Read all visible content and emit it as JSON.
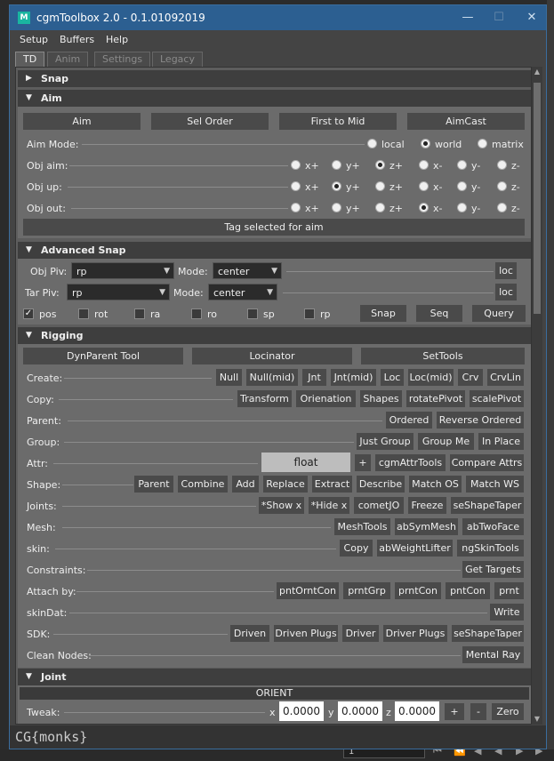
{
  "window": {
    "title": "cgmToolbox 2.0 - 0.1.01092019",
    "icon": "M"
  },
  "menu": [
    "Setup",
    "Buffers",
    "Help"
  ],
  "tabs": [
    "TD",
    "Anim",
    "Settings",
    "Legacy"
  ],
  "sections": {
    "snap": "Snap",
    "aim": "Aim",
    "advanced_snap": "Advanced Snap",
    "rigging": "Rigging",
    "joint": "Joint"
  },
  "aim": {
    "buttons": [
      "Aim",
      "Sel Order",
      "First to Mid",
      "AimCast"
    ],
    "mode_label": "Aim Mode:",
    "modes": [
      "local",
      "world",
      "matrix"
    ],
    "obj_aim_label": "Obj aim:",
    "obj_up_label": "Obj up:",
    "obj_out_label": "Obj out:",
    "axes": [
      "x+",
      "y+",
      "z+",
      "x-",
      "y-",
      "z-"
    ],
    "tag_button": "Tag selected for aim"
  },
  "advanced_snap": {
    "obj_piv_label": "Obj Piv:",
    "obj_piv_value": "rp",
    "tar_piv_label": "Tar Piv:",
    "tar_piv_value": "rp",
    "mode_label": "Mode:",
    "mode1_value": "center",
    "mode2_value": "center",
    "loc": "loc",
    "checks": [
      "pos",
      "rot",
      "ra",
      "ro",
      "sp",
      "rp"
    ],
    "snap": "Snap",
    "seq": "Seq",
    "query": "Query"
  },
  "rigging": {
    "top_buttons": [
      "DynParent Tool",
      "Locinator",
      "SetTools"
    ],
    "rows": [
      {
        "label": "Create:",
        "buttons": [
          "Null",
          "Null(mid)",
          "Jnt",
          "Jnt(mid)",
          "Loc",
          "Loc(mid)",
          "Crv",
          "CrvLin"
        ]
      },
      {
        "label": "Copy:",
        "buttons": [
          "Transform",
          "Orienation",
          "Shapes",
          "rotatePivot",
          "scalePivot"
        ]
      },
      {
        "label": "Parent:",
        "buttons": [
          "Ordered",
          "Reverse Ordered"
        ]
      },
      {
        "label": "Group:",
        "buttons": [
          "Just Group",
          "Group Me",
          "In Place"
        ]
      },
      {
        "label": "Attr:",
        "buttons": [
          "+",
          "cgmAttrTools",
          "Compare Attrs"
        ],
        "field": "float"
      },
      {
        "label": "Shape:",
        "buttons": [
          "Parent",
          "Combine",
          "Add",
          "Replace",
          "Extract",
          "Describe",
          "Match OS",
          "Match WS"
        ]
      },
      {
        "label": "Joints:",
        "buttons": [
          "*Show x",
          "*Hide x",
          "cometJO",
          "Freeze",
          "seShapeTaper"
        ]
      },
      {
        "label": "Mesh:",
        "buttons": [
          "MeshTools",
          "abSymMesh",
          "abTwoFace"
        ]
      },
      {
        "label": "skin:",
        "buttons": [
          "Copy",
          "abWeightLifter",
          "ngSkinTools"
        ]
      },
      {
        "label": "Constraints:",
        "buttons": [
          "Get Targets"
        ]
      },
      {
        "label": "Attach by:",
        "buttons": [
          "pntOrntCon",
          "prntGrp",
          "prntCon",
          "pntCon",
          "prnt"
        ]
      },
      {
        "label": "skinDat:",
        "buttons": [
          "Write"
        ]
      },
      {
        "label": "SDK:",
        "buttons": [
          "Driven",
          "Driven Plugs",
          "Driver",
          "Driver Plugs",
          "seShapeTaper"
        ]
      },
      {
        "label": "Clean Nodes:",
        "buttons": [
          "Mental Ray"
        ]
      }
    ]
  },
  "joint": {
    "orient": "ORIENT",
    "tweak_label": "Tweak:",
    "x_label": "x",
    "y_label": "y",
    "z_label": "z",
    "x": "0.0000",
    "y": "0.0000",
    "z": "0.0000",
    "plus": "+",
    "minus": "-",
    "zero": "Zero"
  },
  "footer": {
    "logo": "CG{monks}"
  },
  "timeline": {
    "frame": "1"
  }
}
